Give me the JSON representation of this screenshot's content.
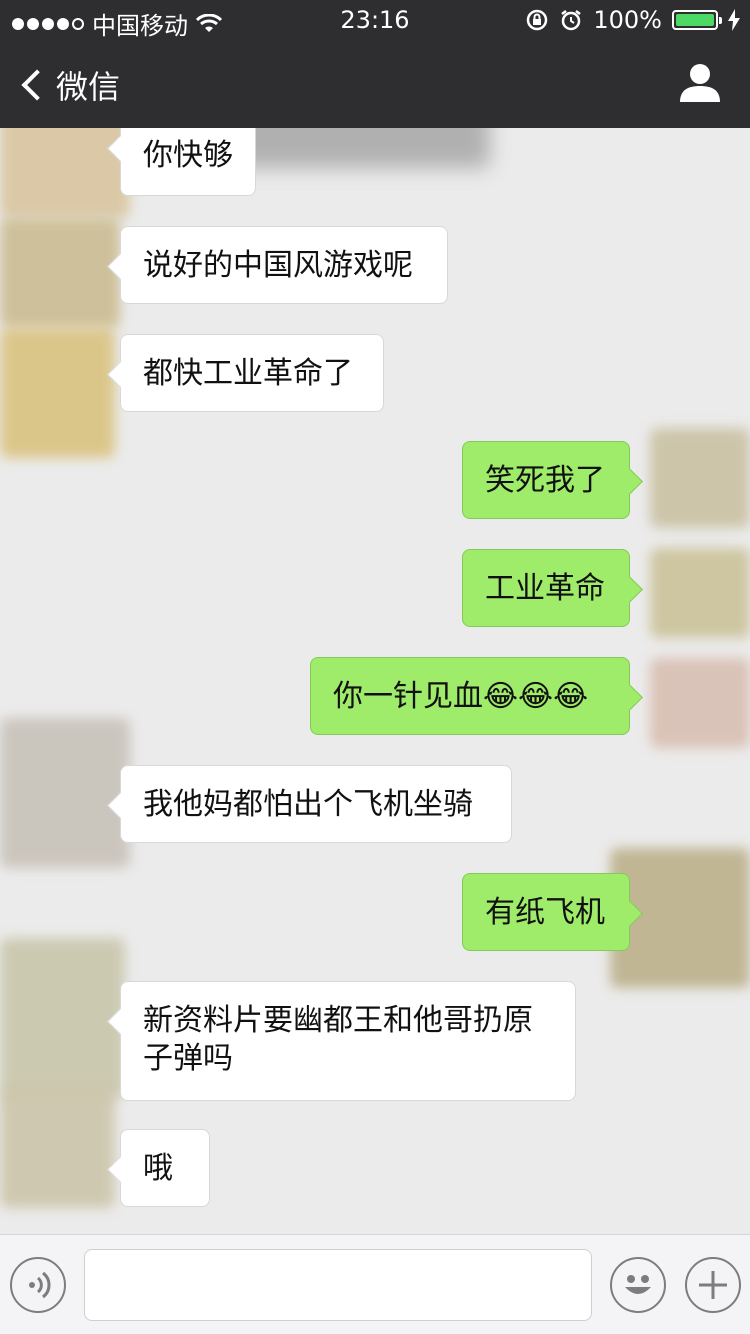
{
  "status_bar": {
    "carrier": "中国移动",
    "time": "23:16",
    "battery": "100%"
  },
  "nav": {
    "back_label": "微信"
  },
  "messages": [
    {
      "side": "left",
      "text": "你快够"
    },
    {
      "side": "left",
      "text": "说好的中国风游戏呢"
    },
    {
      "side": "left",
      "text": "都快工业革命了"
    },
    {
      "side": "right",
      "text": "笑死我了"
    },
    {
      "side": "right",
      "text": "工业革命"
    },
    {
      "side": "right",
      "text": "你一针见血😂😂😂"
    },
    {
      "side": "left",
      "text": "我他妈都怕出个飞机坐骑"
    },
    {
      "side": "right",
      "text": "有纸飞机"
    },
    {
      "side": "left",
      "text": "新资料片要幽都王和他哥扔原子弹吗"
    },
    {
      "side": "left",
      "text": "哦"
    }
  ],
  "colors": {
    "bar": "#2e2e30",
    "chat_bg": "#ebebeb",
    "bubble_right": "#9feb6a",
    "bubble_left": "#ffffff"
  },
  "input": {
    "placeholder": ""
  }
}
